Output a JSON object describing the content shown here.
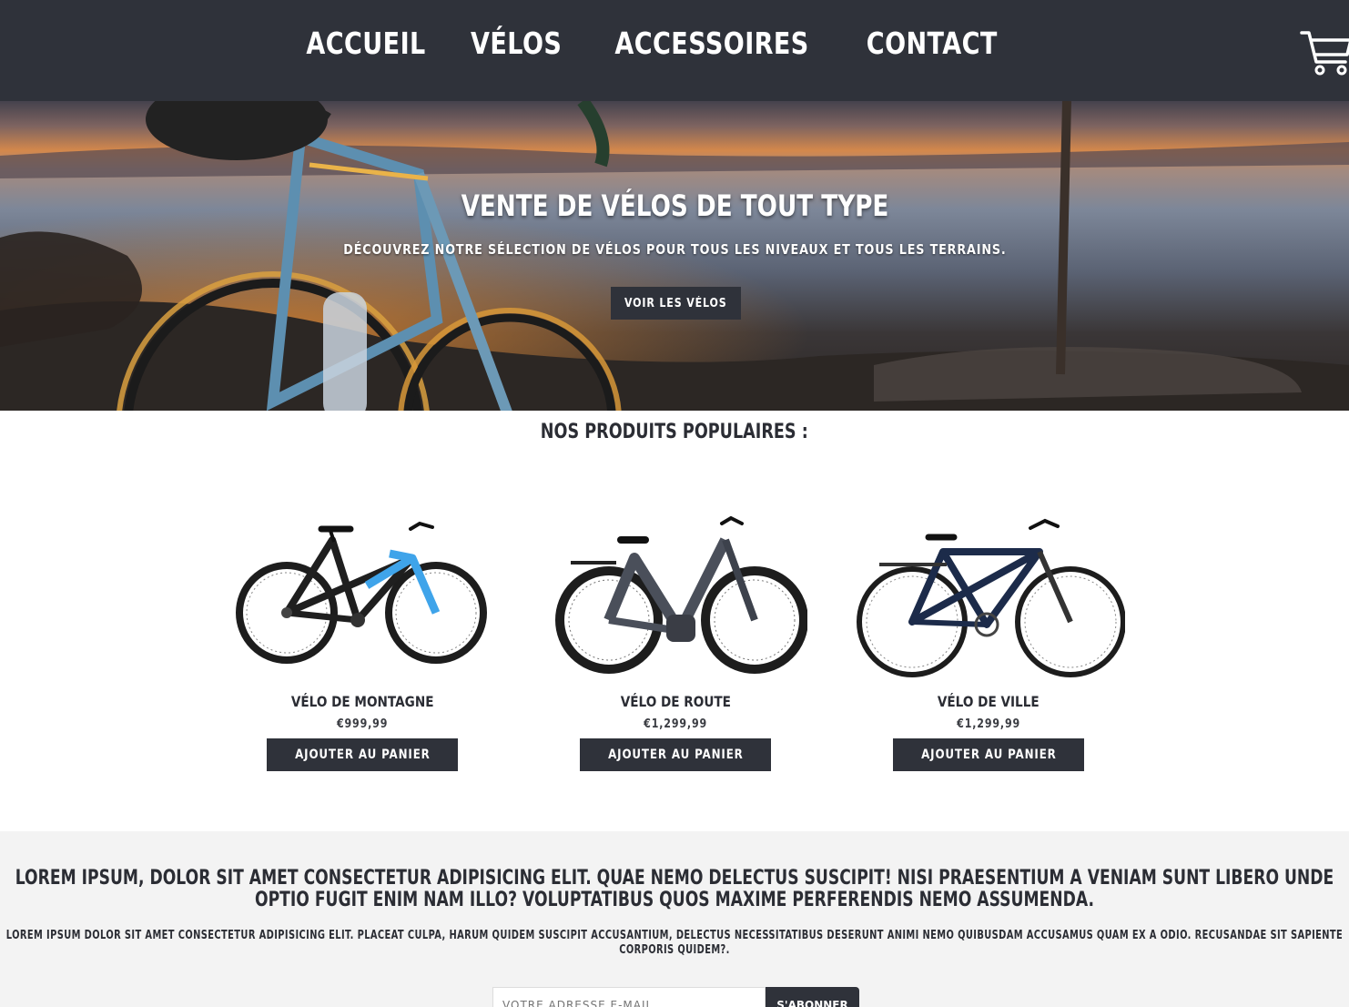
{
  "nav": {
    "items": [
      "ACCUEIL",
      "VÉLOS",
      "ACCESSOIRES",
      "CONTACT"
    ],
    "cart_icon": "shopping-cart-icon"
  },
  "hero": {
    "title": "VENTE DE VÉLOS DE TOUT TYPE",
    "subtitle": "DÉCOUVREZ NOTRE SÉLECTION DE VÉLOS POUR TOUS LES NIVEAUX ET TOUS LES TERRAINS.",
    "button_label": "VOIR LES VÉLOS"
  },
  "products": {
    "section_title": "NOS PRODUITS POPULAIRES :",
    "items": [
      {
        "name": "VÉLO DE MONTAGNE",
        "price": "€999,99",
        "button": "AJOUTER AU PANIER"
      },
      {
        "name": "VÉLO DE ROUTE",
        "price": "€1,299,99",
        "button": "AJOUTER AU PANIER"
      },
      {
        "name": "VÉLO DE VILLE",
        "price": "€1,299,99",
        "button": "AJOUTER AU PANIER"
      }
    ]
  },
  "newsletter": {
    "title": "LOREM IPSUM, DOLOR SIT AMET CONSECTETUR ADIPISICING ELIT. QUAE NEMO DELECTUS SUSCIPIT! NISI PRAESENTIUM A VENIAM SUNT LIBERO UNDE OPTIO FUGIT ENIM NAM ILLO? VOLUPTATIBUS QUOS MAXIME PERFERENDIS NEMO ASSUMENDA.",
    "text": "LOREM IPSUM DOLOR SIT AMET CONSECTETUR ADIPISICING ELIT. PLACEAT CULPA, HARUM QUIDEM SUSCIPIT ACCUSANTIUM, DELECTUS NECESSITATIBUS DESERUNT ANIMI NEMO QUIBUSDAM ACCUSAMUS QUAM EX A ODIO. RECUSANDAE SIT SAPIENTE CORPORIS QUIDEM?.",
    "email_placeholder": "VOTRE ADRESSE E-MAIL",
    "subscribe_label": "S'ABONNER"
  },
  "colors": {
    "dark": "#2f323a",
    "light_bg": "#f3f3f3",
    "accent_blue": "#3b9fe6",
    "navy": "#1c2b4a"
  }
}
